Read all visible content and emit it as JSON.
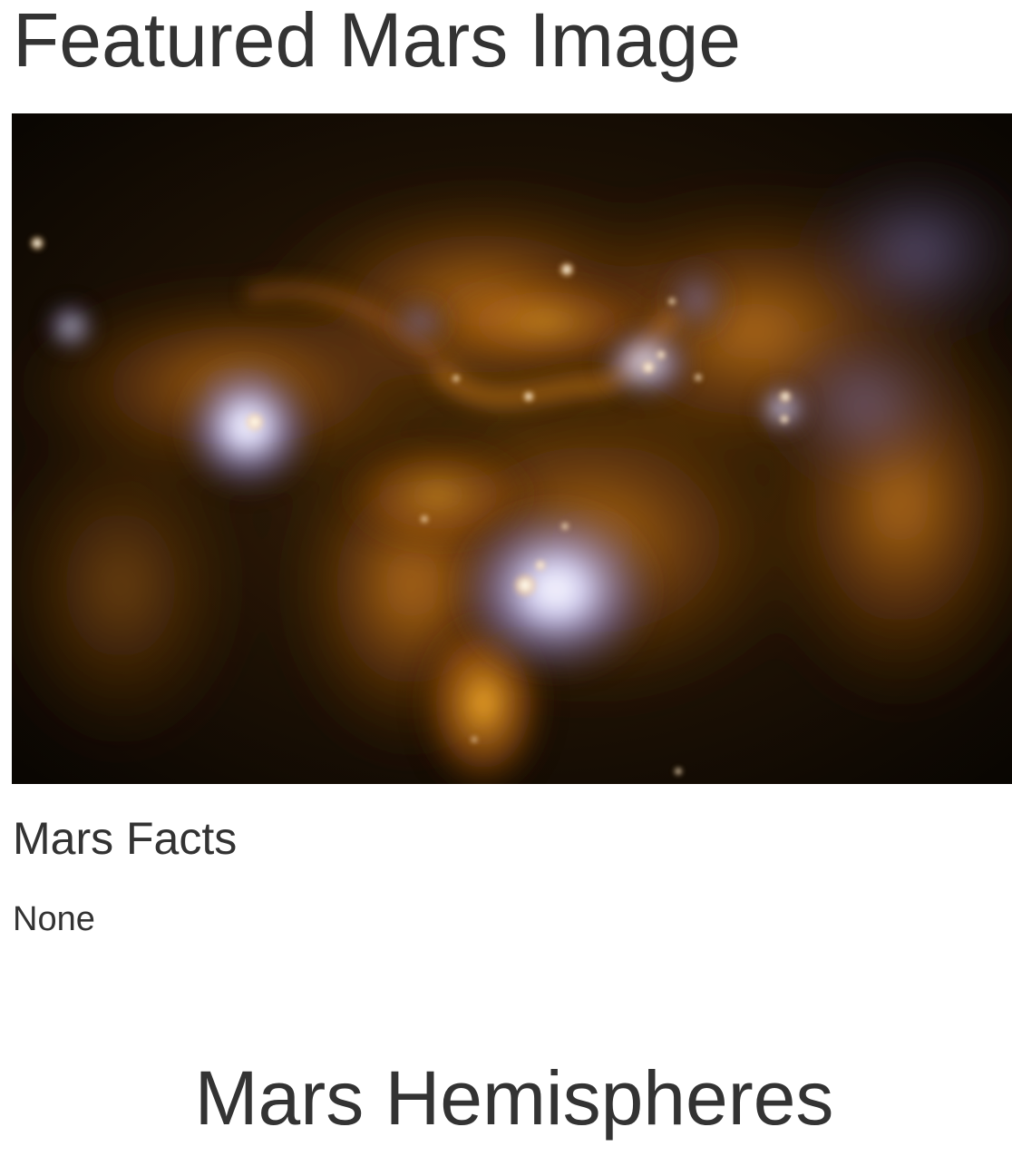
{
  "featured": {
    "title": "Featured Mars Image",
    "image_description_icon": "nebula-image"
  },
  "facts": {
    "title": "Mars Facts",
    "value": "None"
  },
  "hemispheres": {
    "title": "Mars Hemispheres"
  },
  "colors": {
    "text": "#333333",
    "background": "#ffffff"
  }
}
